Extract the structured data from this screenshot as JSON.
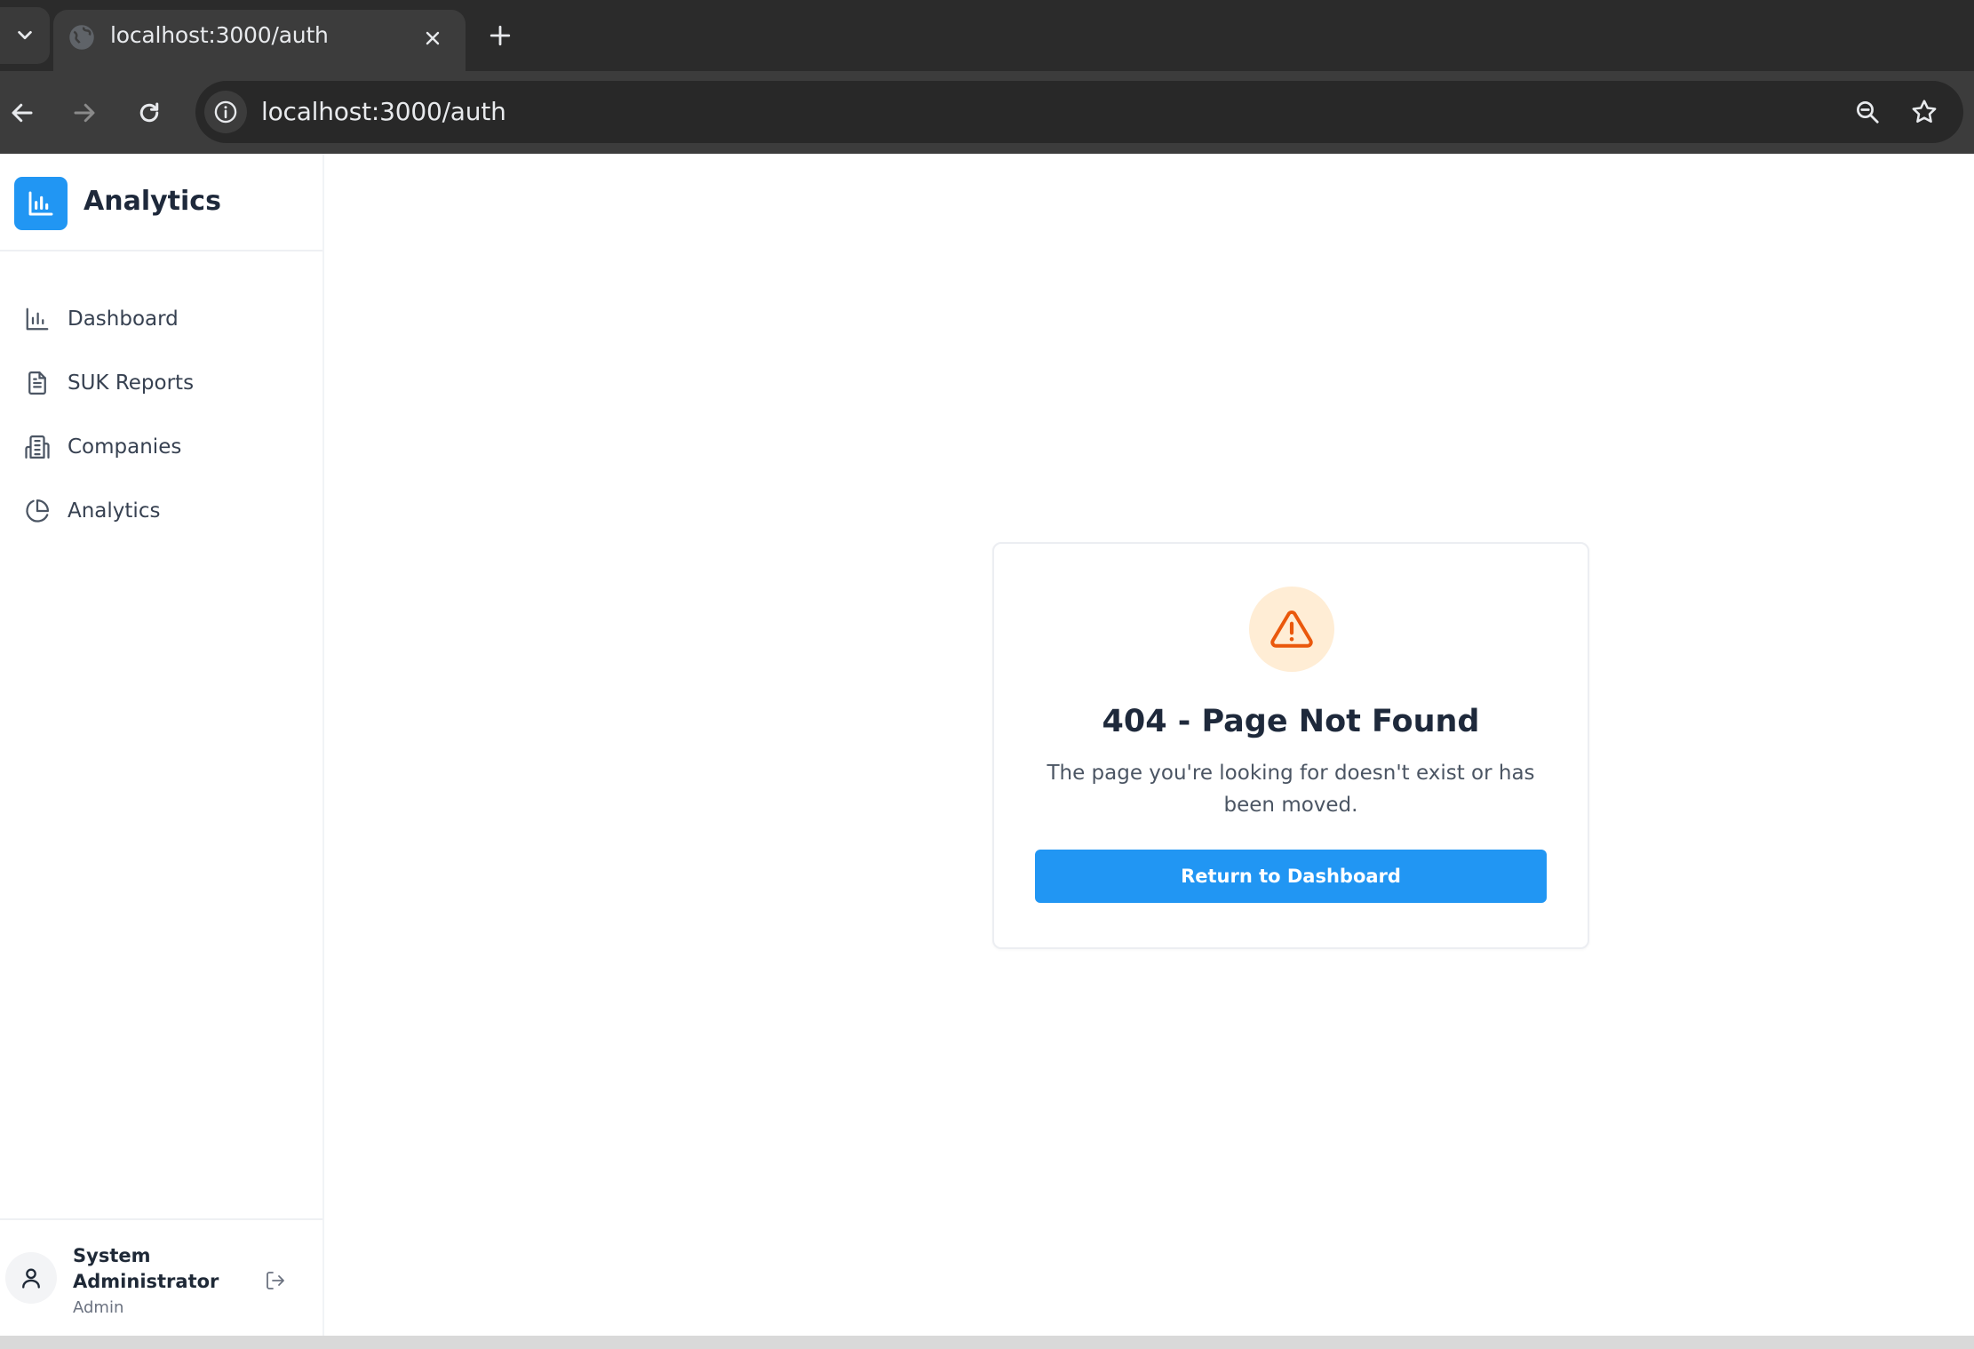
{
  "browser": {
    "tab": {
      "title": "localhost:3000/auth"
    },
    "address_bar": {
      "url": "localhost:3000/auth"
    },
    "icons": {
      "tab_search": "chevron-down-icon",
      "favicon": "globe-icon",
      "tab_close": "close-icon",
      "new_tab": "plus-icon",
      "back": "arrow-left-icon",
      "forward": "arrow-right-icon",
      "reload": "reload-icon",
      "site_info": "info-icon",
      "zoom": "zoom-icon",
      "bookmark": "star-icon"
    }
  },
  "sidebar": {
    "brand": {
      "name": "Analytics",
      "icon": "bar-chart-icon"
    },
    "items": [
      {
        "label": "Dashboard",
        "icon": "bar-chart-icon"
      },
      {
        "label": "SUK Reports",
        "icon": "document-icon"
      },
      {
        "label": "Companies",
        "icon": "building-icon"
      },
      {
        "label": "Analytics",
        "icon": "pie-chart-icon"
      }
    ],
    "user": {
      "name": "System Administrator",
      "role": "Admin",
      "avatar_icon": "user-icon",
      "logout_icon": "logout-icon"
    }
  },
  "main": {
    "error_card": {
      "icon": "warning-triangle-icon",
      "title": "404 - Page Not Found",
      "message": "The page you're looking for doesn't exist or has been moved.",
      "button_label": "Return to Dashboard"
    }
  },
  "colors": {
    "accent": "#2196f3",
    "warning": "#ea580c",
    "warning_bg": "#ffedd5",
    "chrome_dark": "#2b2b2b",
    "chrome_toolbar": "#3c3c3c",
    "text_dark": "#1e293b"
  }
}
